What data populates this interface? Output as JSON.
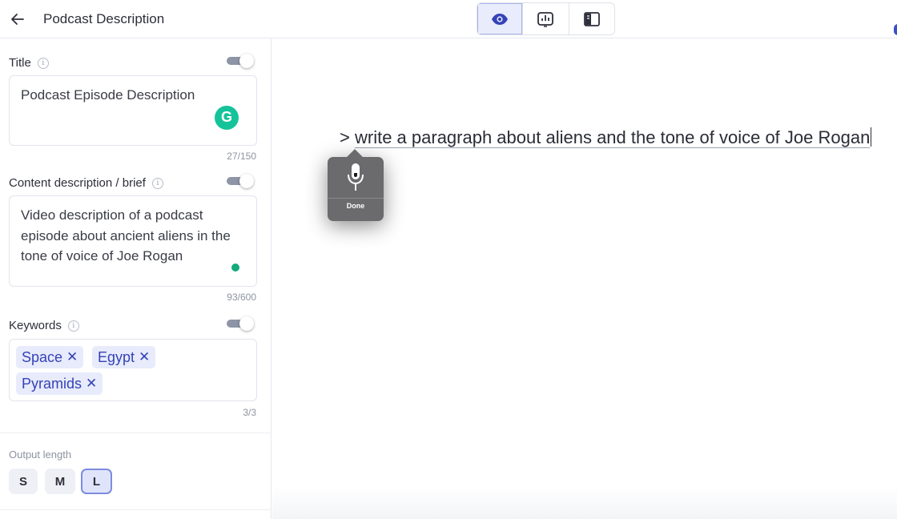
{
  "header": {
    "title": "Podcast Description",
    "views": [
      {
        "name": "preview",
        "icon": "eye-icon",
        "active": true
      },
      {
        "name": "analytics",
        "icon": "chart-icon",
        "active": false
      },
      {
        "name": "layout",
        "icon": "sidebar-icon",
        "active": false
      }
    ]
  },
  "title_field": {
    "label": "Title",
    "value": "Podcast Episode Description",
    "counter": "27/150",
    "enabled": true
  },
  "brief_field": {
    "label": "Content description / brief",
    "value": "Video description of a podcast episode about ancient aliens in the tone of voice of Joe Rogan",
    "counter": "93/600",
    "enabled": true
  },
  "keywords_field": {
    "label": "Keywords",
    "tags": [
      "Space",
      "Egypt",
      "Pyramids"
    ],
    "counter": "3/3",
    "enabled": true
  },
  "output_length": {
    "label": "Output length",
    "options": [
      "S",
      "M",
      "L"
    ],
    "selected": "L"
  },
  "editor": {
    "prompt_marker": ">",
    "prompt_text": "write a paragraph about aliens and the tone of voice of Joe Rogan"
  },
  "dictation": {
    "done_label": "Done"
  },
  "colors": {
    "accent": "#3443b8",
    "toggle_track": "#8d95a6",
    "grammarly": "#15c39a"
  }
}
